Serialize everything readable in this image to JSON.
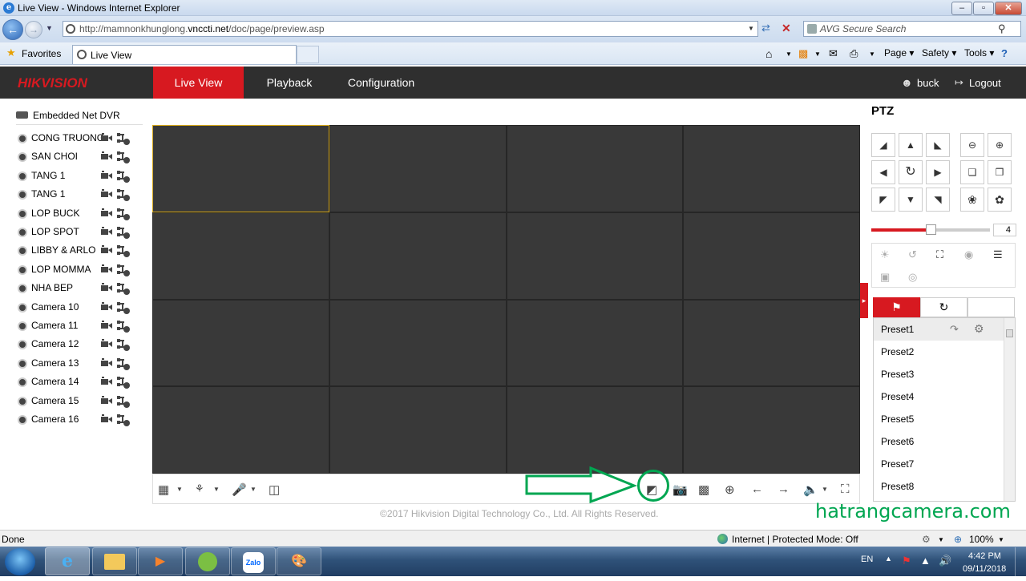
{
  "window": {
    "title": "Live View - Windows Internet Explorer",
    "min": "‒",
    "max": "▫",
    "close": "✕"
  },
  "address": {
    "url_prefix": "http://mamnonkhunglong.",
    "url_domain": "vnccti.net",
    "url_path": "/doc/page/preview.asp",
    "search_placeholder": "AVG Secure Search"
  },
  "favorites": {
    "label": "Favorites",
    "tab_title": "Live View"
  },
  "commandbar": {
    "page": "Page ▾",
    "safety": "Safety ▾",
    "tools": "Tools ▾"
  },
  "header": {
    "logo": "HIKVISION",
    "nav": [
      "Live View",
      "Playback",
      "Configuration"
    ],
    "user": "buck",
    "logout": "Logout"
  },
  "sidebar": {
    "device": "Embedded Net DVR",
    "cameras": [
      "CONG TRUONG",
      "SAN CHOI",
      "TANG 1",
      "TANG 1",
      "LOP BUCK",
      "LOP SPOT",
      "LIBBY & ARLO",
      "LOP MOMMA",
      "NHA BEP",
      "Camera 10",
      "Camera 11",
      "Camera 12",
      "Camera 13",
      "Camera 14",
      "Camera 15",
      "Camera 16"
    ]
  },
  "footer": {
    "copyright": "©2017 Hikvision Digital Technology Co., Ltd. All Rights Reserved.",
    "watermark": "hatrangcamera.com"
  },
  "ptz": {
    "title": "PTZ",
    "speed": "4",
    "speed_level": 0.5,
    "presets": [
      "Preset1",
      "Preset2",
      "Preset3",
      "Preset4",
      "Preset5",
      "Preset6",
      "Preset7",
      "Preset8"
    ]
  },
  "statusbar": {
    "left": "Done",
    "zone": "Internet | Protected Mode: Off",
    "zoom": "100%"
  },
  "tray": {
    "lang": "EN",
    "time": "4:42 PM",
    "date": "09/11/2018"
  },
  "colors": {
    "brand_red": "#d71920",
    "header_bg": "#2f2f2f",
    "selected_border": "#d6a718",
    "annotation_green": "#00a651"
  }
}
